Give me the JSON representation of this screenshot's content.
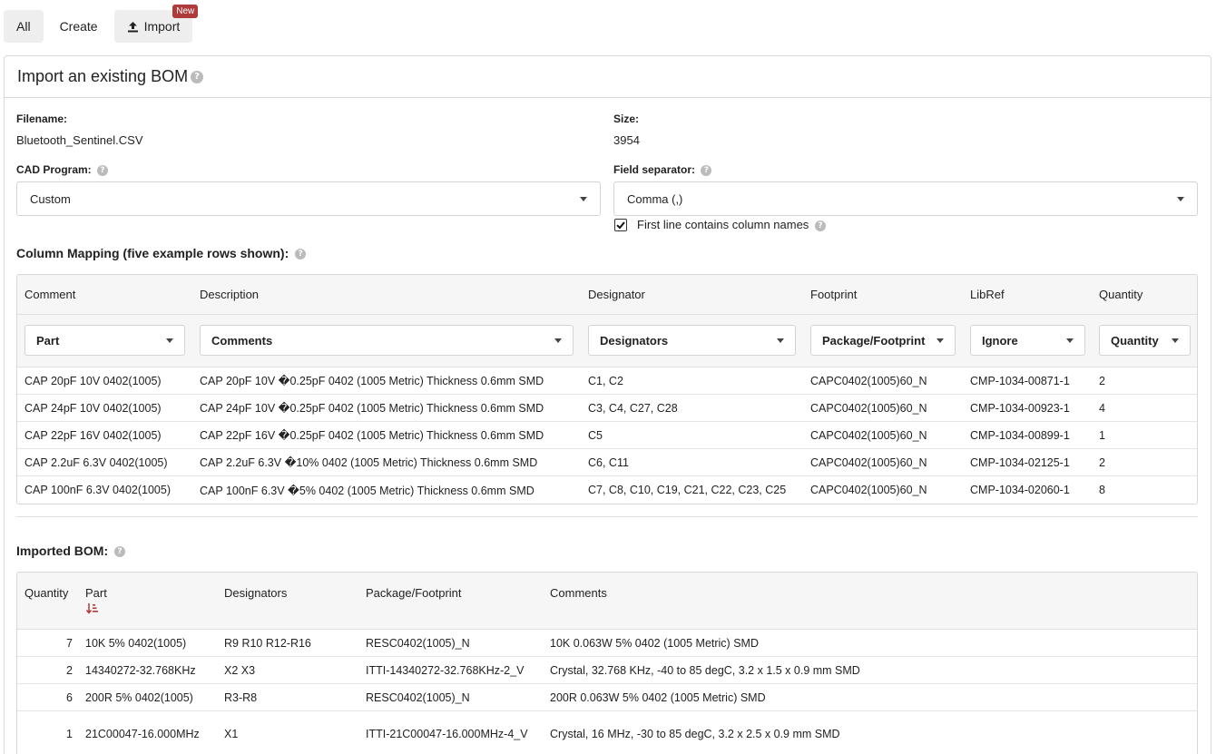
{
  "tabs": {
    "all": "All",
    "create": "Create",
    "import": "Import",
    "badge": "New"
  },
  "panel": {
    "title": "Import an existing BOM"
  },
  "file": {
    "filename_label": "Filename:",
    "filename": "Bluetooth_Sentinel.CSV",
    "size_label": "Size:",
    "size": "3954"
  },
  "cad": {
    "label": "CAD Program:",
    "value": "Custom"
  },
  "separator": {
    "label": "Field separator:",
    "value": "Comma (,)",
    "first_line_label": "First line contains column names",
    "first_line_checked": true
  },
  "mapping": {
    "title": "Column Mapping (five example rows shown):",
    "headers": [
      "Comment",
      "Description",
      "Designator",
      "Footprint",
      "LibRef",
      "Quantity"
    ],
    "selections": [
      "Part",
      "Comments",
      "Designators",
      "Package/Footprint",
      "Ignore",
      "Quantity"
    ],
    "rows": [
      [
        "CAP 20pF 10V 0402(1005)",
        "CAP 20pF 10V �0.25pF 0402 (1005 Metric) Thickness 0.6mm SMD",
        "C1, C2",
        "CAPC0402(1005)60_N",
        "CMP-1034-00871-1",
        "2"
      ],
      [
        "CAP 24pF 10V 0402(1005)",
        "CAP 24pF 10V �0.25pF 0402 (1005 Metric) Thickness 0.6mm SMD",
        "C3, C4, C27, C28",
        "CAPC0402(1005)60_N",
        "CMP-1034-00923-1",
        "4"
      ],
      [
        "CAP 22pF 16V 0402(1005)",
        "CAP 22pF 16V �0.25pF 0402 (1005 Metric) Thickness 0.6mm SMD",
        "C5",
        "CAPC0402(1005)60_N",
        "CMP-1034-00899-1",
        "1"
      ],
      [
        "CAP 2.2uF 6.3V 0402(1005)",
        "CAP 2.2uF 6.3V �10% 0402 (1005 Metric) Thickness 0.6mm SMD",
        "C6, C11",
        "CAPC0402(1005)60_N",
        "CMP-1034-02125-1",
        "2"
      ],
      [
        "CAP 100nF 6.3V 0402(1005)",
        "CAP 100nF 6.3V �5% 0402 (1005 Metric) Thickness 0.6mm SMD",
        "C7, C8, C10, C19, C21, C22, C23, C25",
        "CAPC0402(1005)60_N",
        "CMP-1034-02060-1",
        "8"
      ]
    ]
  },
  "imported": {
    "title": "Imported BOM:",
    "headers": [
      "Quantity",
      "Part",
      "Designators",
      "Package/Footprint",
      "Comments"
    ],
    "rows": [
      [
        "7",
        "10K 5% 0402(1005)",
        "R9 R10 R12-R16",
        "RESC0402(1005)_N",
        "10K 0.063W 5% 0402 (1005 Metric) SMD"
      ],
      [
        "2",
        "14340272-32.768KHz",
        "X2 X3",
        "ITTI-14340272-32.768KHz-2_V",
        "Crystal, 32.768 KHz, -40 to 85 degC, 3.2 x 1.5 x 0.9 mm SMD"
      ],
      [
        "6",
        "200R 5% 0402(1005)",
        "R3-R8",
        "RESC0402(1005)_N",
        "200R 0.063W 5% 0402 (1005 Metric) SMD"
      ],
      [
        "1",
        "21C00047-16.000MHz",
        "X1",
        "ITTI-21C00047-16.000MHz-4_V",
        "Crystal, 16 MHz, -30 to 85 degC, 3.2 x 2.5 x 0.9 mm SMD"
      ]
    ]
  },
  "colors": {
    "accent": "#b03a3a",
    "header_bg": "#f6f6f6",
    "border": "#d8d8d8"
  },
  "icons": {
    "import": "upload-icon",
    "help": "question-circle-icon",
    "sort": "sort-amount-down-icon",
    "caret": "caret-down-icon",
    "check": "check-icon"
  }
}
